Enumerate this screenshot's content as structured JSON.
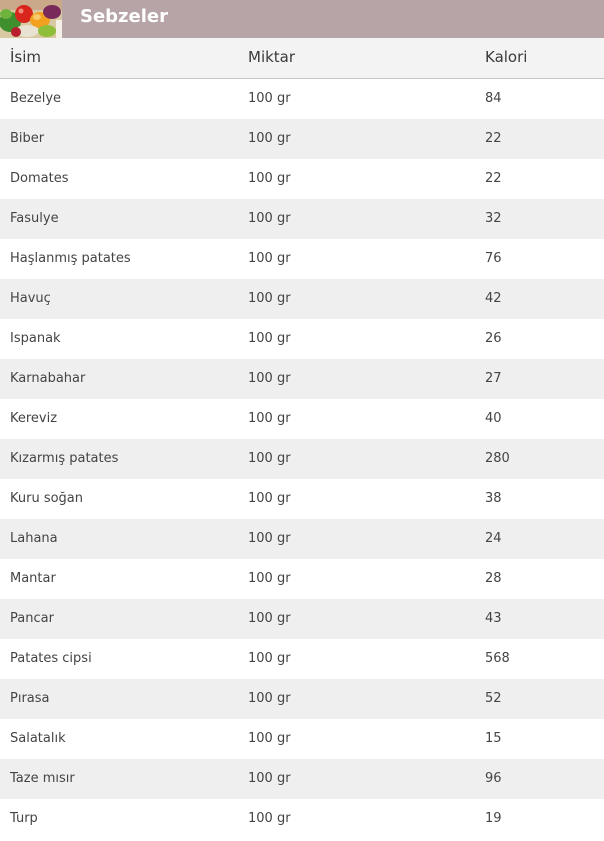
{
  "header": {
    "title": "Sebzeler",
    "thumbnail_icon": "vegetables-photo-thumbnail"
  },
  "table": {
    "columns": [
      "İsim",
      "Miktar",
      "Kalori"
    ],
    "rows": [
      {
        "name": "Bezelye",
        "amount": "100 gr",
        "calories": "84"
      },
      {
        "name": "Biber",
        "amount": "100 gr",
        "calories": "22"
      },
      {
        "name": "Domates",
        "amount": "100 gr",
        "calories": "22"
      },
      {
        "name": "Fasulye",
        "amount": "100 gr",
        "calories": "32"
      },
      {
        "name": "Haşlanmış patates",
        "amount": "100 gr",
        "calories": "76"
      },
      {
        "name": "Havuç",
        "amount": "100 gr",
        "calories": "42"
      },
      {
        "name": "Ispanak",
        "amount": "100 gr",
        "calories": "26"
      },
      {
        "name": "Karnabahar",
        "amount": "100 gr",
        "calories": "27"
      },
      {
        "name": "Kereviz",
        "amount": "100 gr",
        "calories": "40"
      },
      {
        "name": "Kızarmış patates",
        "amount": "100 gr",
        "calories": "280"
      },
      {
        "name": "Kuru soğan",
        "amount": "100 gr",
        "calories": "38"
      },
      {
        "name": "Lahana",
        "amount": "100 gr",
        "calories": "24"
      },
      {
        "name": "Mantar",
        "amount": "100 gr",
        "calories": "28"
      },
      {
        "name": "Pancar",
        "amount": "100 gr",
        "calories": "43"
      },
      {
        "name": "Patates cipsi",
        "amount": "100 gr",
        "calories": "568"
      },
      {
        "name": "Pırasa",
        "amount": "100 gr",
        "calories": "52"
      },
      {
        "name": "Salatalık",
        "amount": "100 gr",
        "calories": "15"
      },
      {
        "name": "Taze mısır",
        "amount": "100 gr",
        "calories": "96"
      },
      {
        "name": "Turp",
        "amount": "100 gr",
        "calories": "19"
      }
    ]
  },
  "colors": {
    "header_background": "#b7a4a7",
    "header_text": "#ffffff",
    "alt_row": "#f0efef",
    "text": "#444444"
  }
}
